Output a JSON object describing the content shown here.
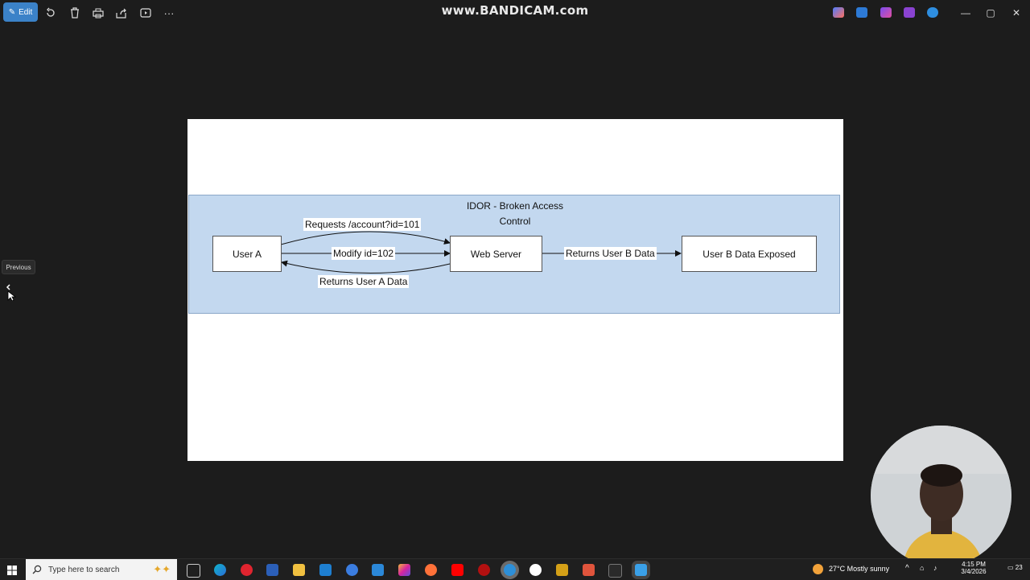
{
  "toolbar": {
    "edit_label": "Edit",
    "watermark": "www.BANDICAM.com"
  },
  "navigation": {
    "previous_tooltip": "Previous"
  },
  "diagram": {
    "cluster_title_line1": "IDOR - Broken Access",
    "cluster_title_line2": "Control",
    "nodes": {
      "user_a": "User A",
      "web_server": "Web Server",
      "user_b_exposed": "User B Data Exposed"
    },
    "edges": {
      "request": "Requests /account?id=101",
      "modify": "Modify id=102",
      "returns_a": "Returns User A Data",
      "returns_b": "Returns User B Data"
    },
    "colors": {
      "cluster_fill": "#c3d8ef",
      "cluster_border": "#8aa7c8",
      "node_border": "#555555"
    }
  },
  "taskbar": {
    "search_placeholder": "Type here to search",
    "weather": "27°C  Mostly sunny",
    "time": "4:15 PM",
    "date": "3/4/2026",
    "notification_count": "23"
  }
}
